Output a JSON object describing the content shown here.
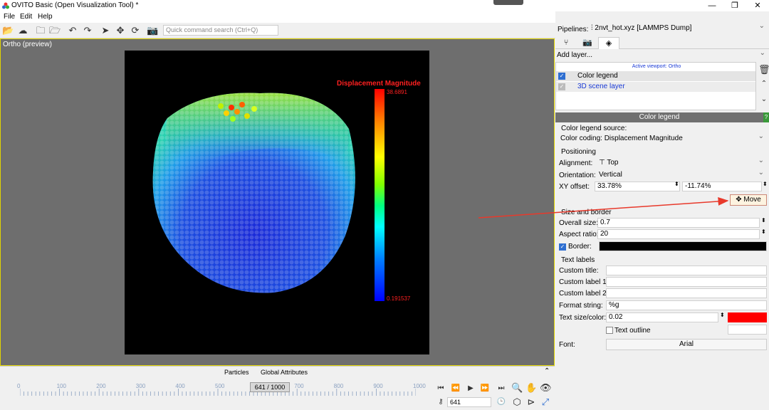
{
  "window": {
    "title": "OVITO Basic (Open Visualization Tool) *",
    "minimize": "—",
    "maximize": "❐",
    "close": "✕"
  },
  "menu": {
    "file": "File",
    "edit": "Edit",
    "help": "Help"
  },
  "toolbar": {
    "search_placeholder": "Quick command search (Ctrl+Q)"
  },
  "viewport": {
    "label": "Ortho (preview)",
    "legend_title": "Displacement Magnitude",
    "legend_max": "38.6891",
    "legend_min": "0.191537"
  },
  "bottom_tabs": {
    "particles": "Particles",
    "global_attributes": "Global Attributes"
  },
  "timeline": {
    "ticks": [
      "0",
      "100",
      "200",
      "300",
      "400",
      "500",
      "600",
      "700",
      "800",
      "900",
      "1000"
    ],
    "frame_display": "641 / 1000",
    "current_frame": "641"
  },
  "pipeline": {
    "label": "Pipelines:",
    "selected": "2nvt_hot.xyz [LAMMPS Dump]",
    "add_layer": "Add layer...",
    "active_viewport": "Active viewport: Ortho",
    "layers": [
      {
        "label": "Color legend",
        "checked": true
      },
      {
        "label": "3D scene layer",
        "checked": true
      }
    ]
  },
  "editor": {
    "header": "Color legend",
    "help": "?",
    "source_label": "Color legend source:",
    "source_value": "Color coding: Displacement Magnitude",
    "positioning_group": "Positioning",
    "alignment_label": "Alignment:",
    "alignment_value": "Top",
    "orientation_label": "Orientation:",
    "orientation_value": "Vertical",
    "xy_offset_label": "XY offset:",
    "x_offset": "33.78%",
    "y_offset": "-11.74%",
    "move_button": "Move",
    "size_group": "Size and border",
    "overall_size_label": "Overall size:",
    "overall_size_value": "0.7",
    "aspect_ratio_label": "Aspect ratio:",
    "aspect_ratio_value": "20",
    "border_label": "Border:",
    "border_color": "#000000",
    "text_group": "Text labels",
    "custom_title_label": "Custom title:",
    "custom_label1_label": "Custom label 1:",
    "custom_label2_label": "Custom label 2:",
    "format_label": "Format string:",
    "format_value": "%g",
    "text_size_label": "Text size/color:",
    "text_size_value": "0.02",
    "text_color": "#ff0000",
    "text_outline_label": "Text outline",
    "font_label": "Font:",
    "font_value": "Arial"
  },
  "colors": {
    "accent": "#2f6fd1",
    "viewport_border": "#e0d400",
    "annotation_arrow": "#e8392b"
  }
}
